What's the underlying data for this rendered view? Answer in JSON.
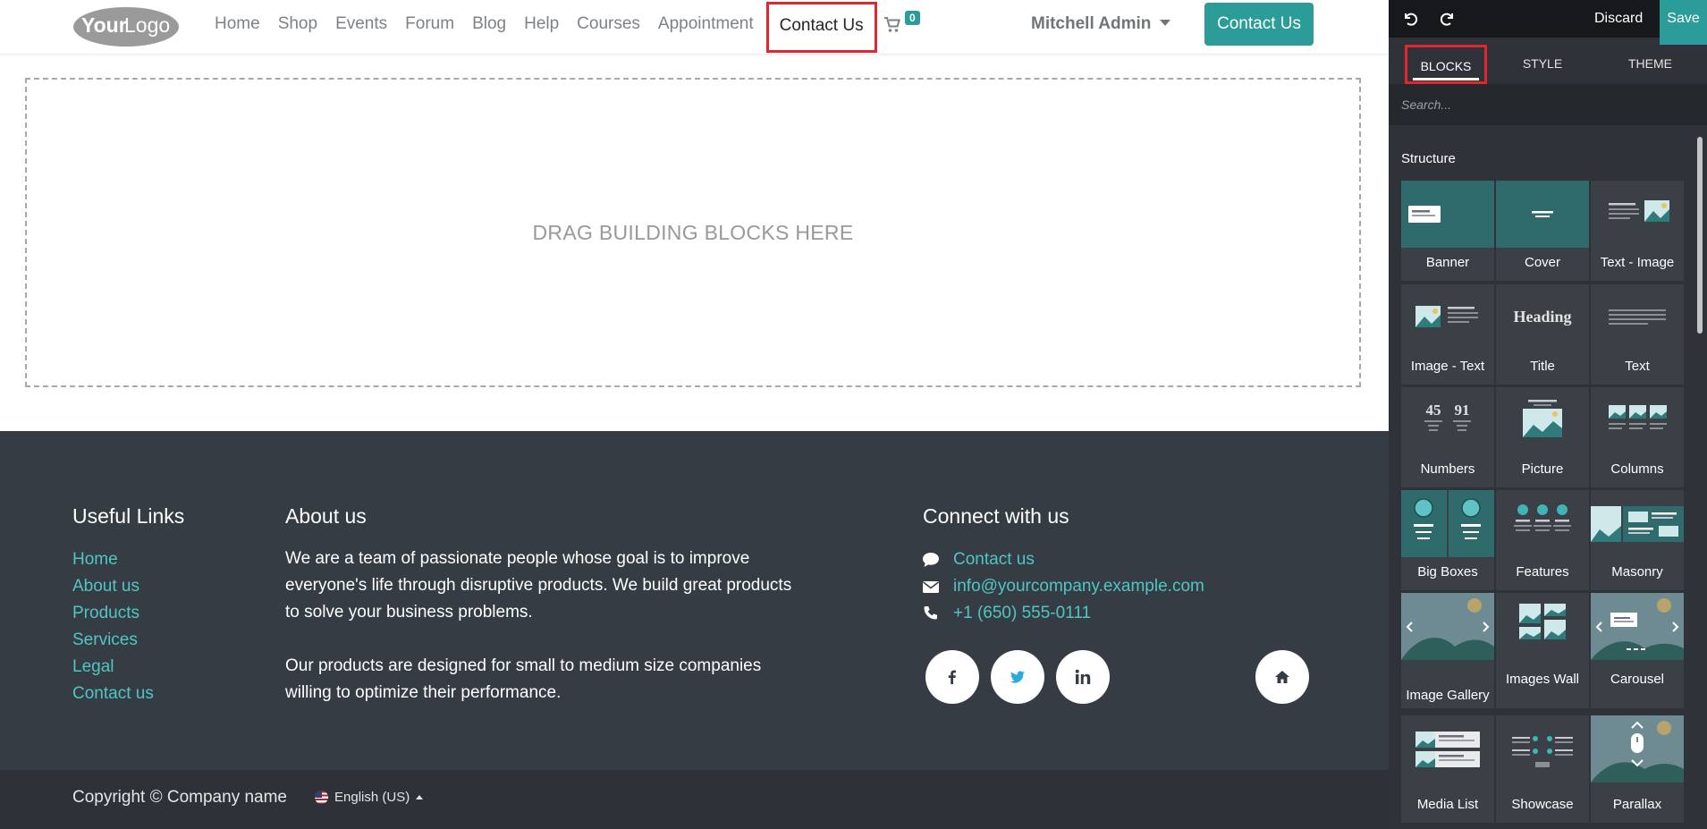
{
  "navbar": {
    "logo_text_bold": "Your",
    "logo_text": "Logo",
    "menu": [
      "Home",
      "Shop",
      "Events",
      "Forum",
      "Blog",
      "Help",
      "Courses",
      "Appointment",
      "Contact Us"
    ],
    "active_index": 8,
    "cart_count": "0",
    "user": "Mitchell Admin",
    "cta": "Contact Us"
  },
  "dropzone": {
    "text": "DRAG BUILDING BLOCKS HERE"
  },
  "footer": {
    "useful_links_title": "Useful Links",
    "useful_links": [
      "Home",
      "About us",
      "Products",
      "Services",
      "Legal",
      "Contact us"
    ],
    "about_title": "About us",
    "about_p1": "We are a team of passionate people whose goal is to improve everyone's life through disruptive products. We build great products to solve your business problems.",
    "about_p2": "Our products are designed for small to medium size companies willing to optimize their performance.",
    "connect_title": "Connect with us",
    "contact_items": [
      {
        "icon": "comment-icon",
        "text": "Contact us"
      },
      {
        "icon": "envelope-icon",
        "text": "info@yourcompany.example.com"
      },
      {
        "icon": "phone-icon",
        "text": "+1 (650) 555-0111"
      }
    ],
    "social_icons": [
      "facebook-icon",
      "twitter-icon",
      "linkedin-icon",
      "home-icon"
    ],
    "copyright": "Copyright © Company name",
    "language": "English (US)"
  },
  "editor": {
    "discard": "Discard",
    "save": "Save",
    "tabs": [
      "BLOCKS",
      "STYLE",
      "THEME"
    ],
    "active_tab": "BLOCKS",
    "search_placeholder": "Search...",
    "section_title": "Structure",
    "blocks": [
      "Banner",
      "Cover",
      "Text - Image",
      "Image - Text",
      "Title",
      "Text",
      "Numbers",
      "Picture",
      "Columns",
      "Big Boxes",
      "Features",
      "Masonry",
      "Image Gallery",
      "Images Wall",
      "Carousel",
      "Media List",
      "Showcase",
      "Parallax"
    ],
    "title_thumb_text": "Heading",
    "numbers_thumb": [
      "45",
      "91"
    ]
  },
  "colors": {
    "accent": "#2c9c98",
    "footer_bg": "#363c44",
    "link": "#4fc6c4",
    "highlight": "#e0262f",
    "panel_bg": "#2f3339"
  }
}
